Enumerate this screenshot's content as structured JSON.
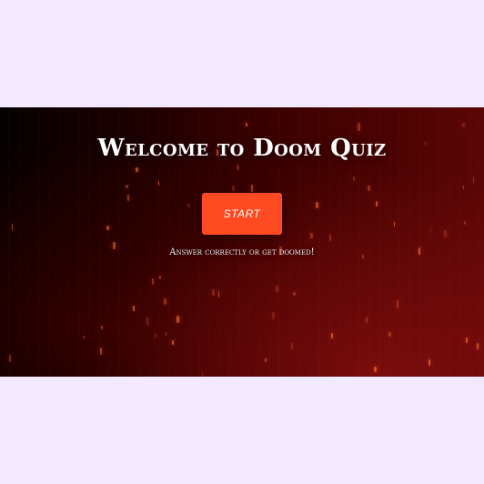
{
  "hero": {
    "title": "Welcome to Doom Quiz",
    "start_label": "START",
    "subtitle": "Answer correctly or get doomed!"
  },
  "colors": {
    "page_background": "#f3eaff",
    "start_button": "#ff4a22",
    "banner_dark": "#050000",
    "banner_red": "#5a0505"
  }
}
